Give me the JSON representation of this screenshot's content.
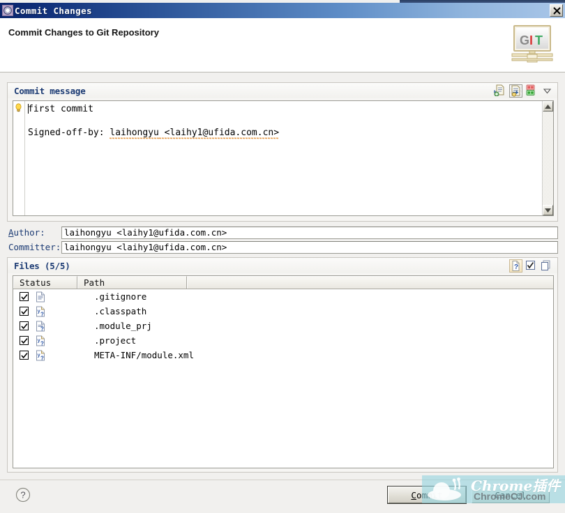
{
  "window": {
    "title": "Commit Changes",
    "icon": "gear-icon",
    "close_label": "×"
  },
  "header": {
    "title": "Commit Changes to Git Repository",
    "logo": {
      "name": "git-logo",
      "letters": [
        "G",
        "I",
        "T"
      ],
      "letter_colors": [
        "#8a8a8a",
        "#d83a3a",
        "#3faa63"
      ]
    }
  },
  "commit_message": {
    "panel_label": "Commit message",
    "tools": [
      {
        "name": "add-signed-off-icon",
        "label": "Add Signed-off-by",
        "state": "normal"
      },
      {
        "name": "insert-change-id-icon",
        "label": "Insert Change-Id",
        "state": "pressed"
      },
      {
        "name": "amend-commit-icon",
        "label": "Amend previous commit",
        "state": "normal"
      },
      {
        "name": "chevron-down-icon",
        "label": "More",
        "state": "normal"
      }
    ],
    "gutter_marker": "lightbulb-icon",
    "lines": [
      "first commit",
      "",
      "Signed-off-by: laihongyu <laihy1@ufida.com.cn>"
    ],
    "text_plain": "first commit",
    "signoff_prefix": "Signed-off-by: ",
    "signoff_name": "laihongyu",
    "signoff_email": " <laihy1@ufida.com.cn>",
    "scrollbar": {
      "up": "scroll-up-arrow",
      "down": "scroll-down-arrow"
    }
  },
  "author": {
    "label_prefix": "A",
    "label_rest": "uthor:",
    "value": "laihongyu <laihy1@ufida.com.cn>"
  },
  "committer": {
    "label": "Committer:",
    "value": "laihongyu <laihy1@ufida.com.cn>"
  },
  "files": {
    "panel_label": "Files (5/5)",
    "checked_count": 5,
    "total_count": 5,
    "tools": [
      {
        "name": "show-untracked-files-icon",
        "label": "Show untracked files",
        "state": "hovered"
      },
      {
        "name": "select-all-icon",
        "label": "Select all",
        "state": "normal"
      },
      {
        "name": "deselect-all-icon",
        "label": "Deselect all",
        "state": "normal"
      }
    ],
    "columns": [
      "Status",
      "Path",
      ""
    ],
    "rows": [
      {
        "checked": true,
        "icon": "file-text-icon",
        "path": ".gitignore"
      },
      {
        "checked": true,
        "icon": "file-xml-unknown-icon",
        "path": ".classpath"
      },
      {
        "checked": true,
        "icon": "file-text-unknown-icon",
        "path": ".module_prj"
      },
      {
        "checked": true,
        "icon": "file-xml-unknown-icon",
        "path": ".project"
      },
      {
        "checked": true,
        "icon": "file-xml-unknown-icon",
        "path": "META-INF/module.xml"
      }
    ]
  },
  "footer": {
    "help": "?",
    "commit": {
      "mnemonic": "C",
      "rest": "ommit",
      "is_default": true
    },
    "cancel": {
      "label": "Cancel"
    }
  },
  "watermark": {
    "main": "Chrome插件",
    "sub": "ChromeCJ.com",
    "accent": "#96d5de"
  }
}
